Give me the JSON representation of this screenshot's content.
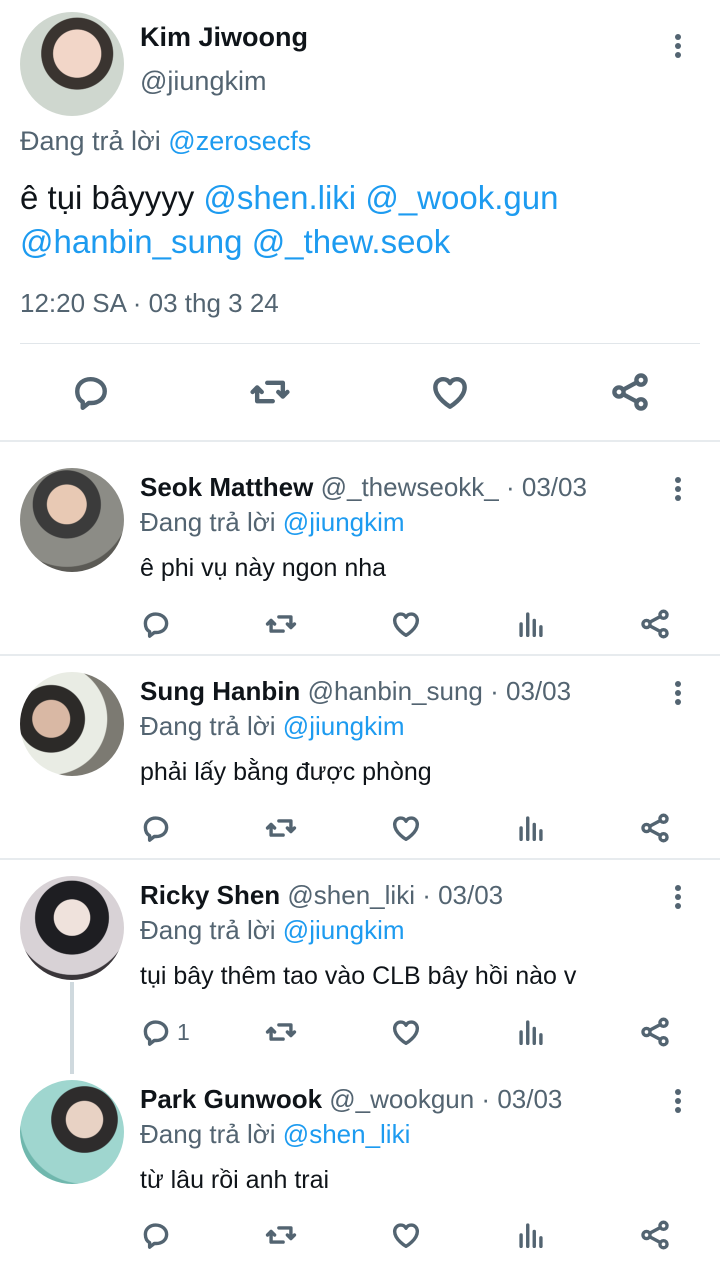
{
  "main_tweet": {
    "name": "Kim Jiwoong",
    "handle": "@jiungkim",
    "replying_prefix": "Đang trả lời",
    "replying_to": "@zerosecfs",
    "text_prefix": "ê tụi bâyyyy",
    "mentions": [
      "@shen.liki",
      "@_wook.gun",
      "@hanbin_sung",
      "@_thew.seok"
    ],
    "time": "12:20 SA · 03 thg 3 24"
  },
  "replies": [
    {
      "name": "Seok Matthew",
      "meta": "@_thewseokk_ · 03/03",
      "replying_prefix": "Đang trả lời",
      "replying_to": "@jiungkim",
      "text": "ê phi vụ này ngon nha",
      "reply_count": ""
    },
    {
      "name": "Sung Hanbin",
      "meta": "@hanbin_sung · 03/03",
      "replying_prefix": "Đang trả lời",
      "replying_to": "@jiungkim",
      "text": "phải lấy bằng được phòng",
      "reply_count": ""
    },
    {
      "name": "Ricky Shen",
      "meta": "@shen_liki · 03/03",
      "replying_prefix": "Đang trả lời",
      "replying_to": "@jiungkim",
      "text": "tụi bây thêm tao vào CLB bây hồi nào v",
      "reply_count": "1"
    },
    {
      "name": "Park Gunwook",
      "meta": "@_wookgun · 03/03",
      "replying_prefix": "Đang trả lời",
      "replying_to": "@shen_liki",
      "text": "từ lâu rồi anh trai",
      "reply_count": ""
    }
  ],
  "icons": {
    "reply": "reply-icon",
    "retweet": "retweet-icon",
    "like": "heart-icon",
    "views": "views-icon",
    "share": "share-icon",
    "more": "more-vertical-icon"
  },
  "colors": {
    "text": "#0f1419",
    "secondary": "#536471",
    "link": "#1d9bf0",
    "divider": "#e7ebee"
  }
}
